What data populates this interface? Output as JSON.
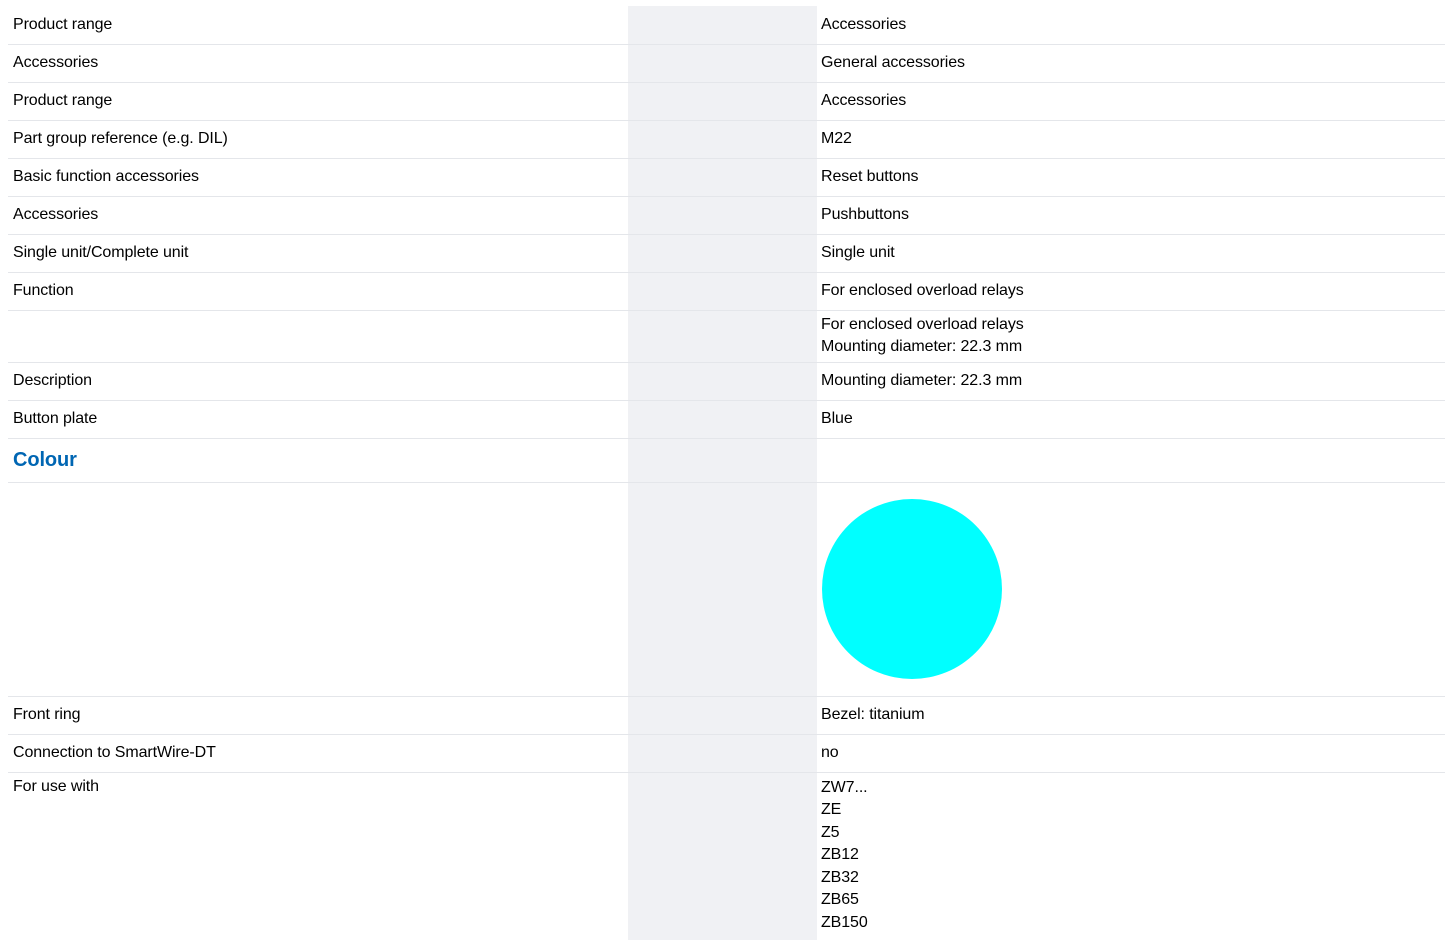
{
  "rows": [
    {
      "label": "Product range",
      "value": "Accessories"
    },
    {
      "label": "Accessories",
      "value": "General accessories"
    },
    {
      "label": "Product range",
      "value": "Accessories"
    },
    {
      "label": "Part group reference (e.g. DIL)",
      "value": "M22"
    },
    {
      "label": "Basic function accessories",
      "value": "Reset buttons"
    },
    {
      "label": "Accessories",
      "value": "Pushbuttons"
    },
    {
      "label": "Single unit/Complete unit",
      "value": "Single unit"
    },
    {
      "label": "Function",
      "value": "For enclosed overload relays"
    },
    {
      "label": "",
      "value_lines": [
        "For enclosed overload relays",
        "Mounting diameter: 22.3 mm"
      ]
    },
    {
      "label": "Description",
      "value": "Mounting diameter: 22.3 mm"
    },
    {
      "label": "Button plate",
      "value": "Blue"
    },
    {
      "section_heading": "Colour"
    },
    {
      "label": "",
      "swatch_color": "#00ffff"
    },
    {
      "label": "Front ring",
      "value": "Bezel: titanium"
    },
    {
      "label": "Connection to SmartWire-DT",
      "value": "no"
    },
    {
      "label": "For use with",
      "value_lines": [
        "ZW7...",
        "ZE",
        "Z5",
        "ZB12",
        "ZB32",
        "ZB65",
        "ZB150"
      ]
    }
  ],
  "colors": {
    "heading": "#0066b3",
    "gutter": "#f0f1f4",
    "row_divider": "#e4e6ea"
  }
}
